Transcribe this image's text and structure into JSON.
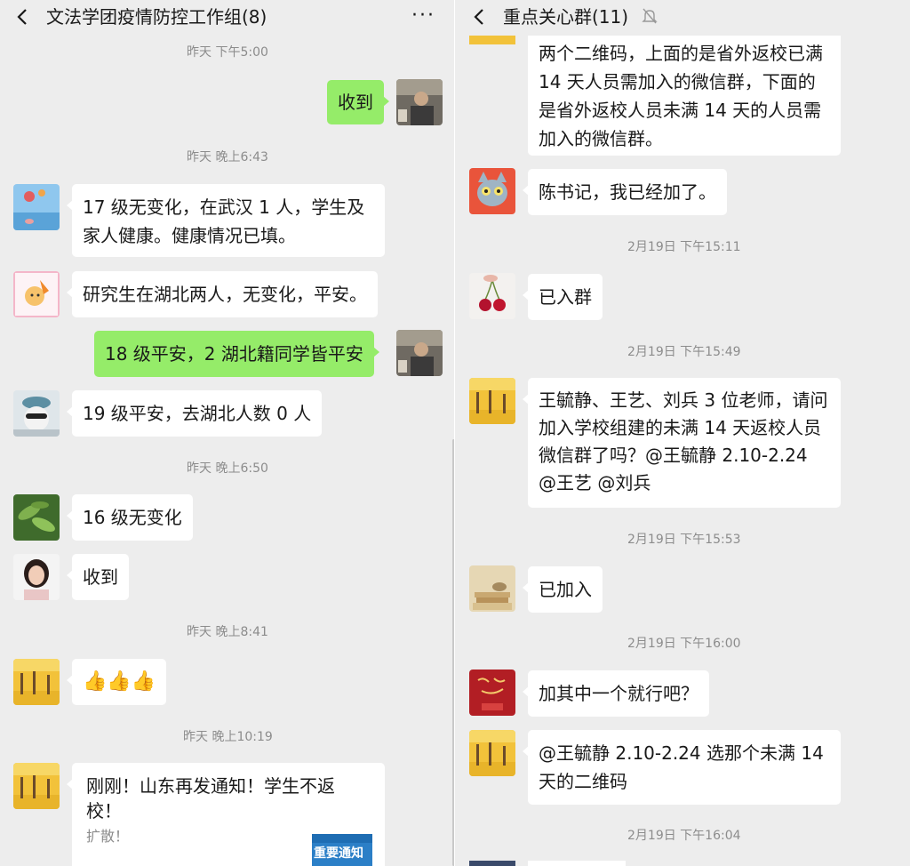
{
  "left": {
    "title": "文法学团疫情防控工作组(8)",
    "more": "···",
    "times": [
      "昨天 下午5:00",
      "昨天 晚上6:43",
      "昨天 晚上6:50",
      "昨天 晚上8:41",
      "昨天 晚上10:19"
    ],
    "messages": {
      "m1": "收到",
      "m2": "17 级无变化，在武汉 1 人，学生及家人健康。健康情况已填。",
      "m3": "研究生在湖北两人，无变化，平安。",
      "m4": "18 级平安，2 湖北籍同学皆平安",
      "m5": "19 级平安，去湖北人数 0 人",
      "m6": "16 级无变化",
      "m7": "收到",
      "m8": "👍👍👍",
      "m9_title": "刚刚！山东再发通知！学生不返校！",
      "m9_sub": "扩散！",
      "m9_thumb": "重要通知"
    }
  },
  "right": {
    "title": "重点关心群(11)",
    "times": [
      "2月19日 下午15:11",
      "2月19日 下午15:49",
      "2月19日 下午15:53",
      "2月19日 下午16:00",
      "2月19日 下午16:04"
    ],
    "messages": {
      "r1": "两个二维码，上面的是省外返校已满 14 天人员需加入的微信群，下面的是省外返校人员未满 14 天的人员需加入的微信群。",
      "r2": "陈书记，我已经加了。",
      "r3": "已入群",
      "r4": "王毓静、王艺、刘兵 3 位老师，请问加入学校组建的未满 14 天返校人员微信群了吗？@王毓静 2.10-2.24 @王艺 @刘兵",
      "r5": "已加入",
      "r6": "加其中一个就行吧？",
      "r7": "@王毓静 2.10-2.24 选那个未满 14 天的二维码"
    }
  },
  "colors": {
    "bubble_me": "#95ec69",
    "bubble_in": "#ffffff",
    "background": "#ededed",
    "timestamp": "#8c8c8c"
  }
}
